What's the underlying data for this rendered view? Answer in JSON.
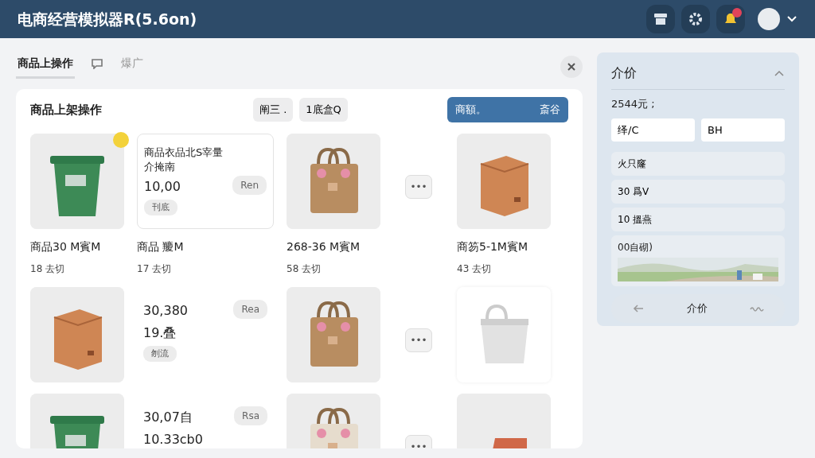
{
  "window": {
    "title": "电商经营模拟器R(5.6on)"
  },
  "header": {
    "notification_badge": true,
    "profile_menu_expanded": false
  },
  "tabs": [
    {
      "kind": "text",
      "label": "商品上操作",
      "selected": true
    },
    {
      "kind": "icon",
      "selected": false
    },
    {
      "kind": "text",
      "label": "爆广",
      "selected": false
    }
  ],
  "panel": {
    "title": "商品上架操作",
    "filters": [
      "阐三 .",
      "1底盒Q"
    ],
    "primary_button": {
      "label": "商額。",
      "extra": "斎谷"
    },
    "rows": [
      {
        "cells": [
          {
            "kind": "product",
            "badge": true,
            "name": "商品30 M賓M",
            "sales": "18 去切"
          },
          {
            "kind": "detail",
            "outlined": true,
            "lines": [
              "商品衣品北S宰量",
              "介掩南"
            ],
            "price": "10,00",
            "action": "Ren",
            "tag": "刊底",
            "name": "商品 羻M",
            "sales": "17 去切"
          },
          {
            "kind": "product",
            "name": "268-36 M賓M",
            "sales": "58 去切"
          },
          {
            "kind": "more",
            "label": "•••"
          },
          {
            "kind": "product",
            "name": "商笏5-1M賓M",
            "sales": "43 去切"
          }
        ]
      },
      {
        "cells": [
          {
            "kind": "product"
          },
          {
            "kind": "detail",
            "price": "30,380",
            "second": "19.叠",
            "action": "Rea",
            "tag": "刎流"
          },
          {
            "kind": "product"
          },
          {
            "kind": "more",
            "label": "•••"
          },
          {
            "kind": "product",
            "white": true
          }
        ]
      },
      {
        "cells": [
          {
            "kind": "product"
          },
          {
            "kind": "detail",
            "price": "30,07自",
            "second": "10.33сb0",
            "action": "Rsa"
          },
          {
            "kind": "product"
          },
          {
            "kind": "more",
            "label": "•••"
          },
          {
            "kind": "product"
          }
        ]
      }
    ]
  },
  "sidebar": {
    "title": "介价",
    "expanded": true,
    "summary": "2544元 ;",
    "fields": [
      {
        "value": "绎/C"
      },
      {
        "value": "BH"
      }
    ],
    "items": [
      "火只窿",
      "30 爲V",
      "10 搵燕"
    ],
    "card": {
      "title": "00自砌)"
    },
    "footer": {
      "label": "介价"
    }
  }
}
